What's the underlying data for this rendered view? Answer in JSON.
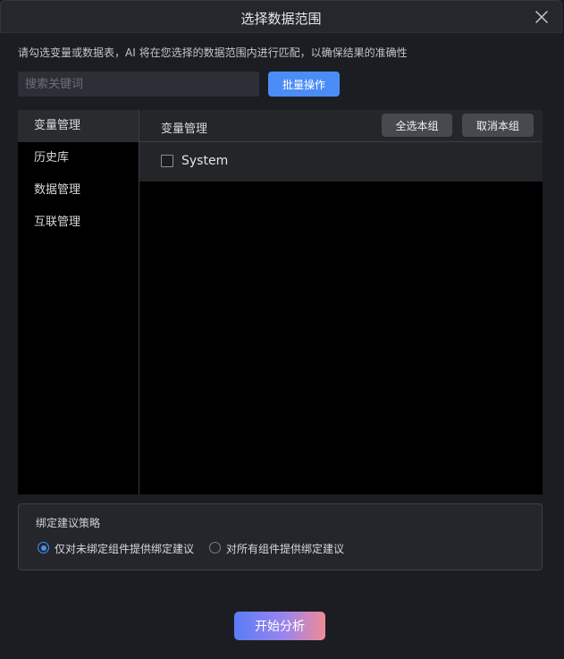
{
  "dialog": {
    "title": "选择数据范围",
    "hint": "请勾选变量或数据表，AI 将在您选择的数据范围内进行匹配，以确保结果的准确性"
  },
  "search": {
    "placeholder": "搜索关键词",
    "value": ""
  },
  "toolbar": {
    "batch_label": "批量操作"
  },
  "sidebar": {
    "items": [
      {
        "label": "变量管理",
        "active": true
      },
      {
        "label": "历史库",
        "active": false
      },
      {
        "label": "数据管理",
        "active": false
      },
      {
        "label": "互联管理",
        "active": false
      }
    ]
  },
  "content": {
    "title": "变量管理",
    "select_group_label": "全选本组",
    "cancel_group_label": "取消本组",
    "groups": [
      {
        "label": "System",
        "checked": false
      }
    ]
  },
  "strategy": {
    "title": "绑定建议策略",
    "options": [
      {
        "label": "仅对未绑定组件提供绑定建议",
        "selected": true
      },
      {
        "label": "对所有组件提供绑定建议",
        "selected": false
      }
    ]
  },
  "footer": {
    "start_label": "开始分析"
  },
  "colors": {
    "accent": "#4b8cf7",
    "background": "#1b1d22",
    "panel": "#000000"
  },
  "icons": {
    "close": "close-icon"
  }
}
